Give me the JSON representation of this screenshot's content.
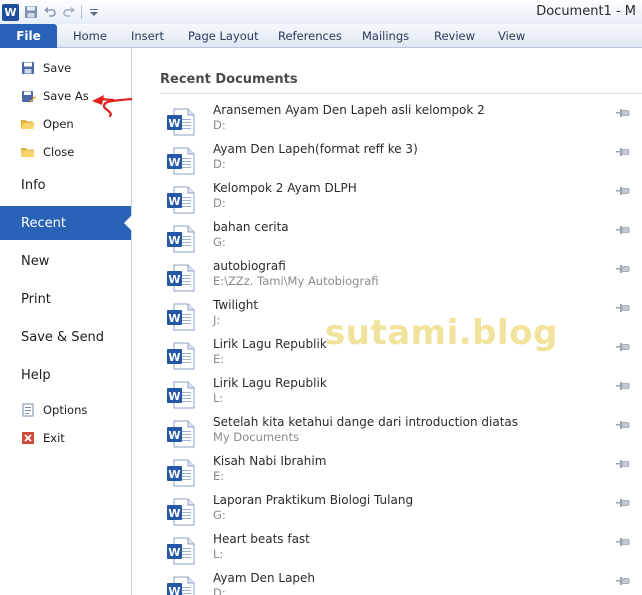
{
  "titlebar": {
    "app_logo": "W",
    "document_title": "Document1 - M",
    "qat_icons": [
      "save-icon",
      "undo-icon",
      "redo-icon",
      "customize-qat-icon"
    ]
  },
  "ribbon": {
    "file_label": "File",
    "tabs": [
      "Home",
      "Insert",
      "Page Layout",
      "References",
      "Mailings",
      "Review",
      "View"
    ]
  },
  "nav": {
    "save": "Save",
    "save_as": "Save As",
    "open": "Open",
    "close": "Close",
    "info": "Info",
    "recent": "Recent",
    "new": "New",
    "print": "Print",
    "save_send": "Save & Send",
    "help": "Help",
    "options": "Options",
    "exit": "Exit"
  },
  "main": {
    "heading": "Recent Documents",
    "documents": [
      {
        "name": "Aransemen Ayam Den Lapeh asli kelompok 2",
        "path": "D:"
      },
      {
        "name": "Ayam Den Lapeh(format reff ke 3)",
        "path": "D:"
      },
      {
        "name": "Kelompok 2 Ayam DLPH",
        "path": "D:"
      },
      {
        "name": "bahan cerita",
        "path": "G:"
      },
      {
        "name": "autobiografi",
        "path": "E:\\ZZz. Tami\\My Autobiografi"
      },
      {
        "name": "Twilight",
        "path": "J:"
      },
      {
        "name": "Lirik Lagu Republik",
        "path": "E:"
      },
      {
        "name": "Lirik Lagu Republik",
        "path": "L:"
      },
      {
        "name": "Setelah kita ketahui dange dari introduction diatas",
        "path": "My Documents"
      },
      {
        "name": "Kisah Nabi Ibrahim",
        "path": "E:"
      },
      {
        "name": "Laporan Praktikum Biologi Tulang",
        "path": "G:"
      },
      {
        "name": "Heart beats fast",
        "path": "L:"
      },
      {
        "name": "Ayam Den Lapeh",
        "path": "D:"
      }
    ]
  },
  "watermark": "sutami.blog",
  "colors": {
    "accent": "#2a62b7",
    "watermark": "#f1e29c",
    "annotation_arrow": "#e0201c"
  }
}
